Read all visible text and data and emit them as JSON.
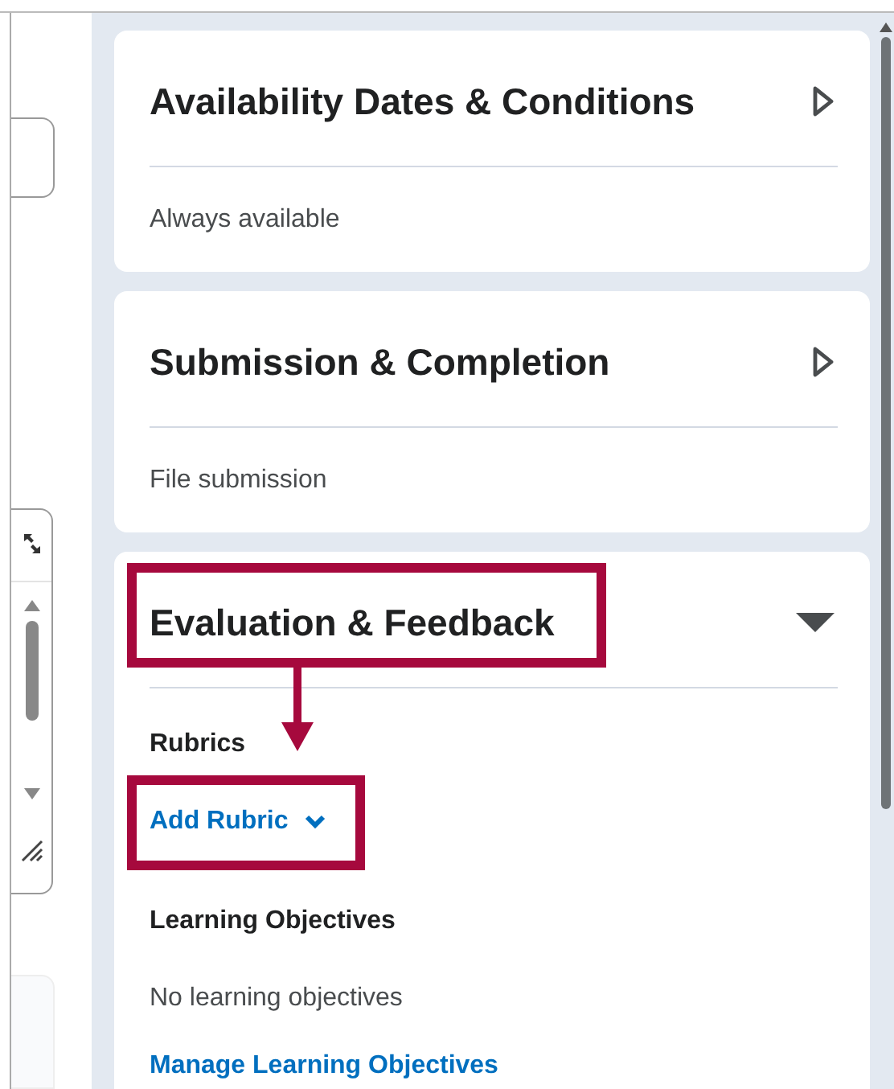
{
  "sections": [
    {
      "title": "Availability Dates & Conditions",
      "expanded": false,
      "highlighted": false,
      "summary": "Always available"
    },
    {
      "title": "Submission & Completion",
      "expanded": false,
      "highlighted": false,
      "summary": "File submission"
    },
    {
      "title": "Evaluation & Feedback",
      "expanded": true,
      "highlighted": true,
      "callout_arrow": true,
      "groups": [
        {
          "label": "Rubrics",
          "items": [
            {
              "kind": "dropdown_link",
              "text": "Add Rubric",
              "highlighted": true
            }
          ]
        },
        {
          "label": "Learning Objectives",
          "items": [
            {
              "kind": "text",
              "text": "No learning objectives",
              "highlighted": false
            },
            {
              "kind": "link",
              "text": "Manage Learning Objectives",
              "highlighted": false
            }
          ]
        }
      ]
    }
  ]
}
